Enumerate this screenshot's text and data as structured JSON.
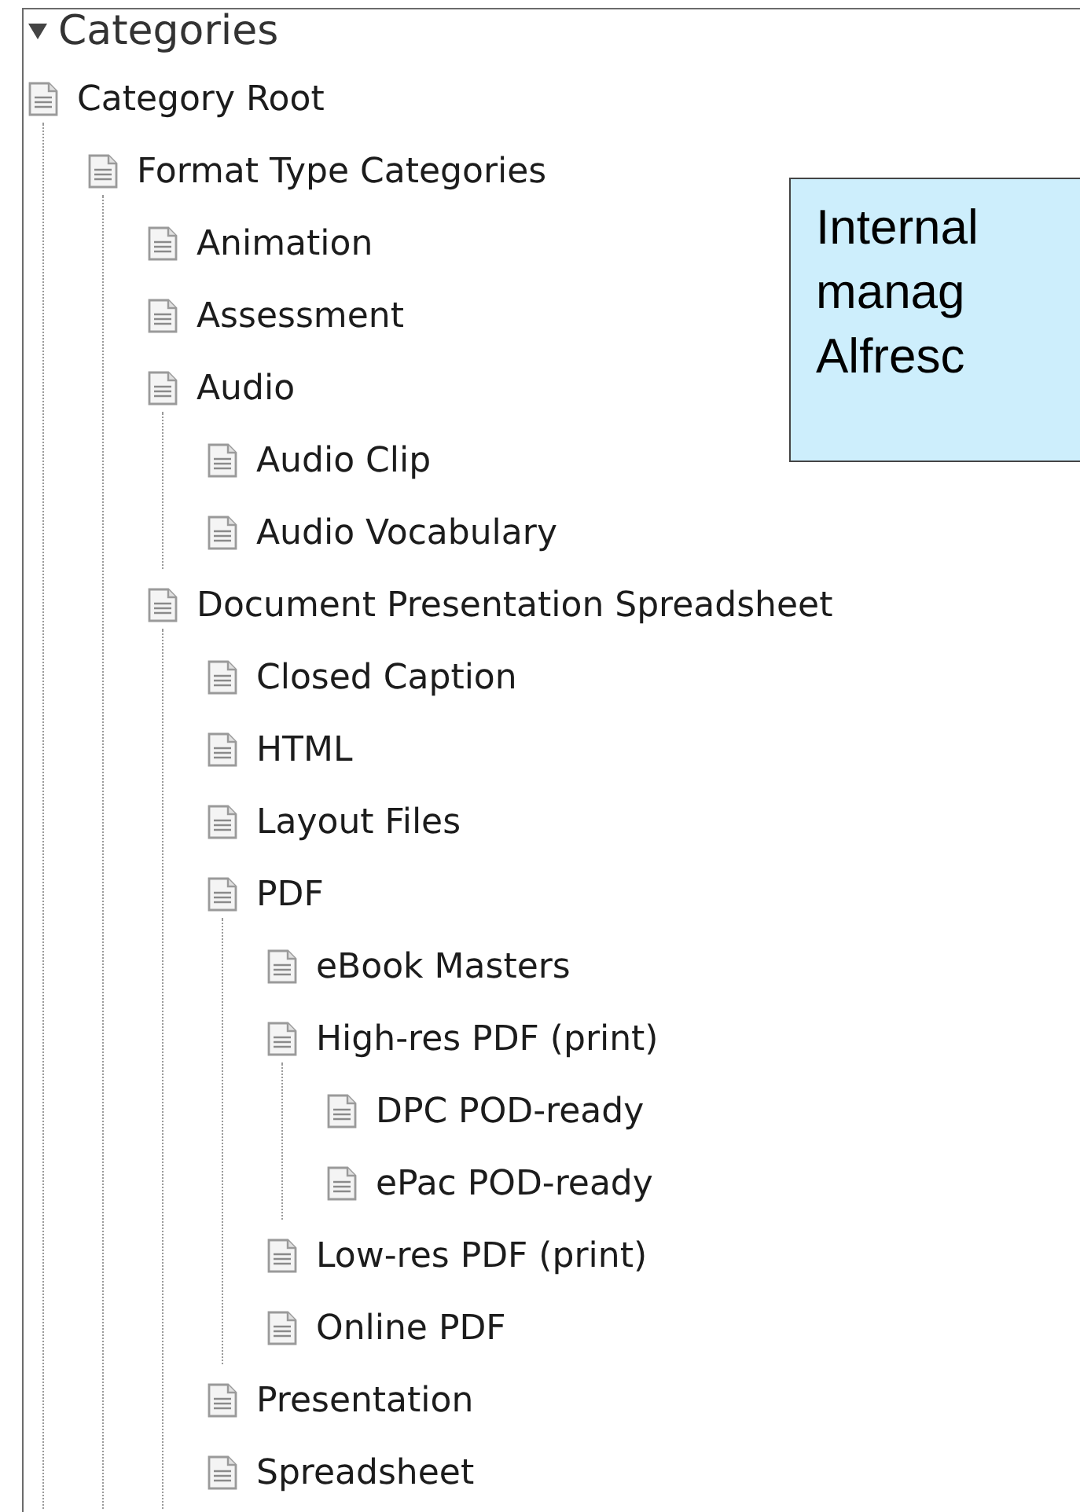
{
  "panel": {
    "title": "Categories",
    "expanded": true
  },
  "tree": [
    {
      "label": "Category Root",
      "children": [
        {
          "label": "Format Type Categories",
          "children": [
            {
              "label": "Animation"
            },
            {
              "label": "Assessment"
            },
            {
              "label": "Audio",
              "children": [
                {
                  "label": "Audio Clip"
                },
                {
                  "label": "Audio Vocabulary"
                }
              ]
            },
            {
              "label": "Document Presentation Spreadsheet",
              "children": [
                {
                  "label": "Closed Caption"
                },
                {
                  "label": "HTML"
                },
                {
                  "label": "Layout Files"
                },
                {
                  "label": "PDF",
                  "children": [
                    {
                      "label": "eBook Masters"
                    },
                    {
                      "label": "High-res PDF (print)",
                      "children": [
                        {
                          "label": "DPC POD-ready"
                        },
                        {
                          "label": "ePac POD-ready"
                        }
                      ]
                    },
                    {
                      "label": "Low-res PDF (print)"
                    },
                    {
                      "label": "Online PDF"
                    }
                  ]
                },
                {
                  "label": "Presentation"
                },
                {
                  "label": "Spreadsheet"
                }
              ]
            }
          ]
        }
      ]
    }
  ],
  "callout": {
    "lines": [
      "Internal",
      "manag",
      "Alfresc"
    ]
  }
}
